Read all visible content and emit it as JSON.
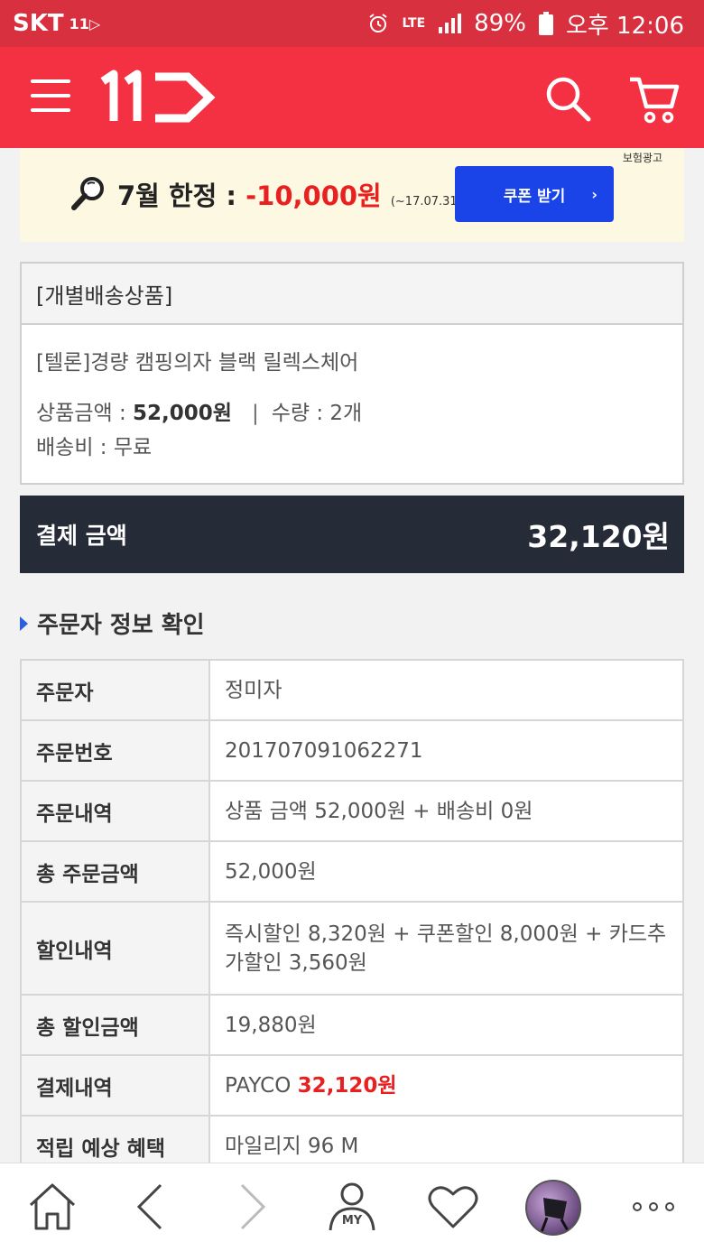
{
  "status_bar": {
    "carrier": "SKT",
    "carrier_badge": "11",
    "network": "LTE",
    "battery": "89%",
    "time": "오후 12:06"
  },
  "header": {
    "logo_text": "11",
    "icons": [
      "menu-icon",
      "search-icon",
      "cart-icon"
    ]
  },
  "banner": {
    "ad_tag": "보험광고",
    "promo_prefix": "7월 한정 : ",
    "promo_amount": "-10,000원",
    "promo_period": "(~17.07.31)",
    "coupon_button": "쿠폰 받기",
    "coupon_arrow": "›",
    "colors": {
      "amount": "#e82020",
      "button": "#1a44e8"
    }
  },
  "product": {
    "shipping_type": "[개별배송상품]",
    "name": "[텔론]경량 캠핑의자 블랙 릴렉스체어",
    "price_label": "상품금액 : ",
    "price_value": "52,000원",
    "separator": "|",
    "qty": "수량 : 2개",
    "shipping_fee": "배송비 : 무료"
  },
  "payment": {
    "label": "결제 금액",
    "amount": "32,120원"
  },
  "section_title": "주문자 정보 확인",
  "orderer_info": [
    {
      "key": "주문자",
      "value": "정미자"
    },
    {
      "key": "주문번호",
      "value": "201707091062271"
    },
    {
      "key": "주문내역",
      "value": "상품 금액 52,000원 + 배송비 0원"
    },
    {
      "key": "총 주문금액",
      "value": "52,000원"
    },
    {
      "key": "할인내역",
      "value": "즉시할인 8,320원 + 쿠폰할인 8,000원 + 카드추가할인 3,560원"
    },
    {
      "key": "총 할인금액",
      "value": "19,880원"
    },
    {
      "key": "결제내역",
      "value_prefix": "PAYCO ",
      "value_amount": "32,120원"
    },
    {
      "key": "적립 예상 혜택",
      "value": "마일리지 96 M"
    }
  ],
  "bottom_nav": {
    "my_label": "MY",
    "items": [
      "home-icon",
      "back-icon",
      "forward-icon",
      "my-icon",
      "heart-icon",
      "recent-item-thumbnail",
      "more-icon"
    ]
  },
  "colors": {
    "brand": "#f43142",
    "status_bar": "#d9303f",
    "pay_bar": "#262b38",
    "accent_blue": "#2c5fe0"
  }
}
